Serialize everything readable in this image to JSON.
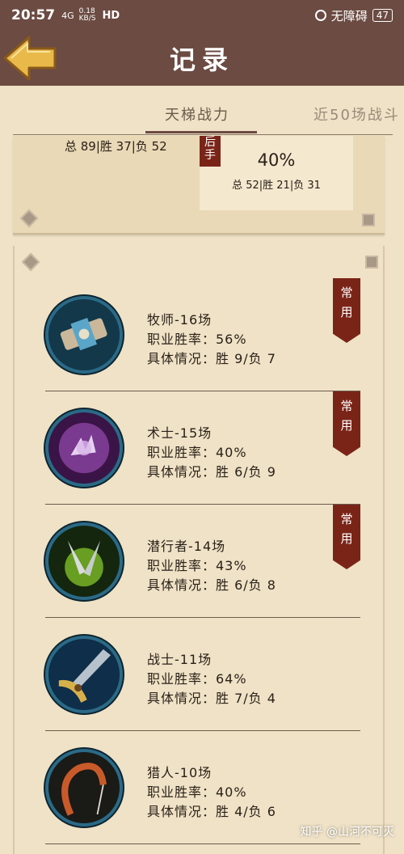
{
  "status_bar": {
    "time": "20:57",
    "signal": "4G",
    "speed_value": "0.18",
    "speed_unit": "KB/S",
    "hd": "HD",
    "accessibility": "无障碍",
    "battery": "47"
  },
  "header": {
    "title": "记录"
  },
  "tabs": [
    {
      "label": "天梯战力"
    },
    {
      "label": "近50场战斗"
    }
  ],
  "summary": {
    "left_stats": "总 89|胜 37|负 52",
    "rank_tag": "后手",
    "pct": "40%",
    "sub_stats": "总 52|胜 21|负 31"
  },
  "classes": [
    {
      "name": "牧师-16场",
      "rate": "职业胜率：56%",
      "detail": "具体情况：胜 9/负 7",
      "badge": "常用",
      "icon": "priest-icon"
    },
    {
      "name": "术士-15场",
      "rate": "职业胜率：40%",
      "detail": "具体情况：胜 6/负 9",
      "badge": "常用",
      "icon": "warlock-icon"
    },
    {
      "name": "潜行者-14场",
      "rate": "职业胜率：43%",
      "detail": "具体情况：胜 6/负 8",
      "badge": "常用",
      "icon": "rogue-icon"
    },
    {
      "name": "战士-11场",
      "rate": "职业胜率：64%",
      "detail": "具体情况：胜 7/负 4",
      "badge": "",
      "icon": "warrior-icon"
    },
    {
      "name": "猎人-10场",
      "rate": "职业胜率：40%",
      "detail": "具体情况：胜 4/负 6",
      "badge": "",
      "icon": "hunter-icon"
    }
  ],
  "watermark": "知乎 @山河不可灭",
  "colors": {
    "header_bg": "#6b4b42",
    "page_bg": "#efe2c6",
    "ribbon": "#7a2418"
  }
}
